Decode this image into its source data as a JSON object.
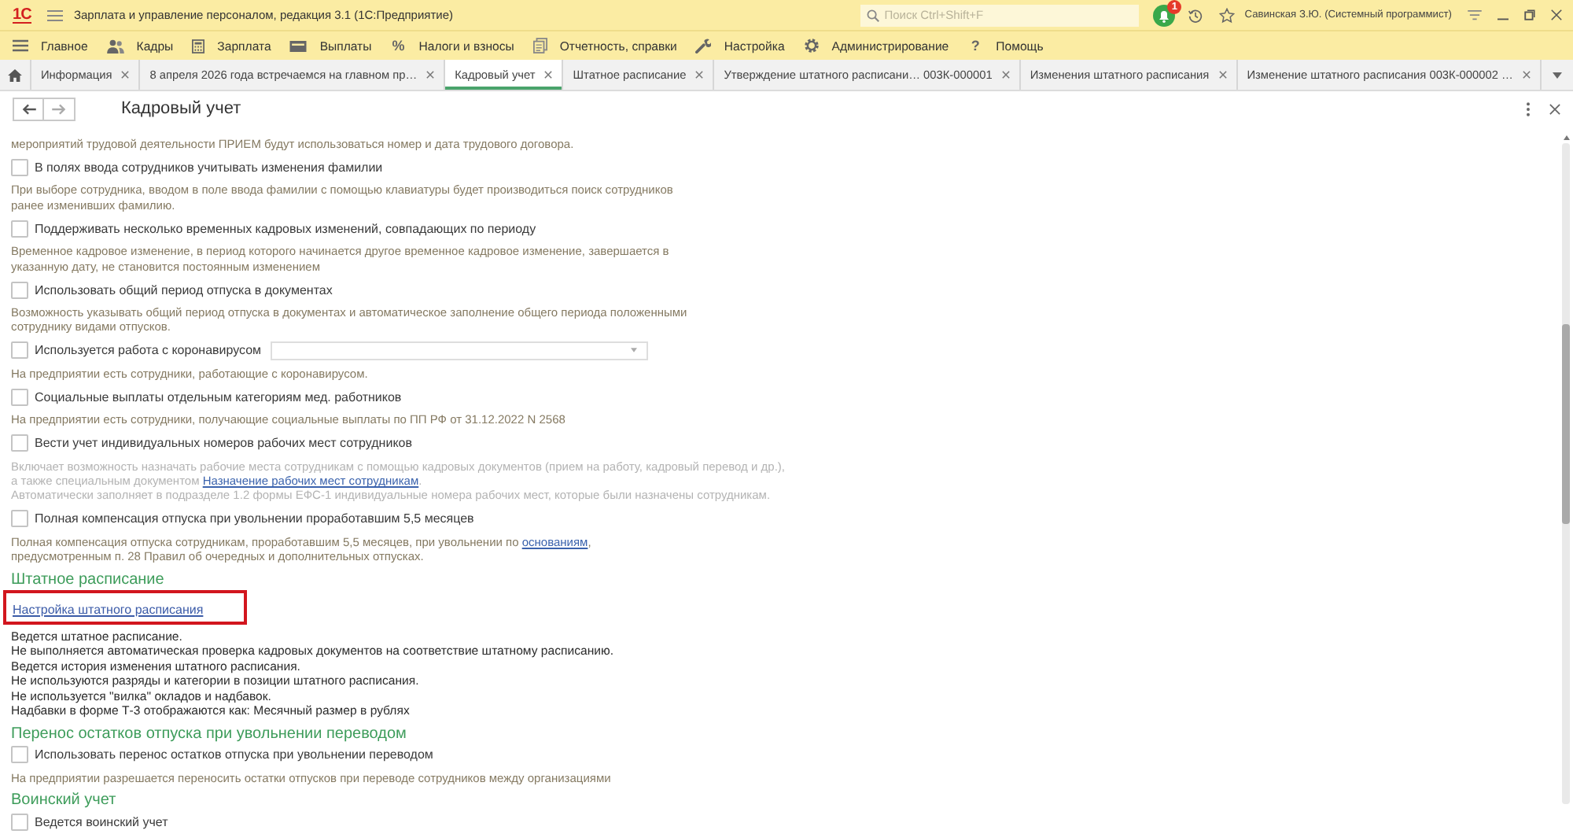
{
  "window": {
    "logo": "1С",
    "title": "Зарплата и управление персоналом, редакция 3.1 (1С:Предприятие)",
    "search": {
      "placeholder": "Поиск Ctrl+Shift+F"
    },
    "notification_count": "1",
    "user": "Савинская З.Ю. (Системный программист)"
  },
  "sections": [
    {
      "label": "Главное",
      "selected": false
    },
    {
      "label": "Кадры",
      "selected": false
    },
    {
      "label": "Зарплата",
      "selected": false
    },
    {
      "label": "Выплаты",
      "selected": false
    },
    {
      "label": "Налоги и взносы",
      "glyph": "%",
      "selected": false
    },
    {
      "label": "Отчетность, справки",
      "selected": false
    },
    {
      "label": "Настройка",
      "selected": false
    },
    {
      "label": "Администрирование",
      "selected": false
    },
    {
      "label": "Помощь",
      "glyph": "?",
      "selected": false
    }
  ],
  "tabs": [
    {
      "label": "Информация",
      "selected": false
    },
    {
      "label": "8 апреля 2026 года встречаемся на главном пр…",
      "selected": false
    },
    {
      "label": "Кадровый учет",
      "selected": true
    },
    {
      "label": "Штатное расписание",
      "selected": false
    },
    {
      "label": "Утверждение штатного расписани… 003К-000001",
      "selected": false
    },
    {
      "label": "Изменения штатного расписания",
      "selected": false
    },
    {
      "label": "Изменение штатного расписания 003К-000002 …",
      "selected": false
    }
  ],
  "form": {
    "title": "Кадровый учет"
  },
  "content": [
    {
      "kind": "note",
      "disabled": false,
      "lines": [
        "мероприятий трудовой деятельности ПРИЕМ будут использоваться номер и дата трудового договора."
      ]
    },
    {
      "kind": "checkbox",
      "label": "В полях ввода сотрудников учитывать изменения фамилии",
      "checked": false
    },
    {
      "kind": "note",
      "disabled": false,
      "lines": [
        "При выборе сотрудника, вводом в поле ввода фамилии с помощью клавиатуры будет производиться поиск сотрудников",
        "ранее изменивших фамилию."
      ]
    },
    {
      "kind": "checkbox",
      "label": "Поддерживать несколько временных кадровых изменений, совпадающих по периоду",
      "checked": false
    },
    {
      "kind": "note",
      "disabled": false,
      "lines": [
        "Временное кадровое изменение, в период которого начинается другое временное кадровое изменение, завершается в",
        "указанную дату, не становится постоянным изменением"
      ]
    },
    {
      "kind": "checkbox",
      "label": "Использовать общий период отпуска в документах",
      "checked": false
    },
    {
      "kind": "note",
      "disabled": false,
      "lines": [
        "Возможность указывать общий период отпуска в документах и автоматическое заполнение общего периода положенными",
        "сотруднику видами отпусков."
      ]
    },
    {
      "kind": "checkbox_select",
      "label": "Используется работа с коронавирусом",
      "checked": false
    },
    {
      "kind": "note",
      "disabled": false,
      "lines": [
        "На предприятии есть сотрудники, работающие с коронавирусом."
      ]
    },
    {
      "kind": "checkbox",
      "label": "Социальные выплаты отдельным категориям мед. работников",
      "checked": false
    },
    {
      "kind": "note",
      "disabled": false,
      "lines": [
        "На предприятии есть сотрудники, получающие социальные выплаты по ПП РФ от 31.12.2022 N 2568"
      ]
    },
    {
      "kind": "checkbox",
      "label": "Вести учет индивидуальных номеров рабочих мест сотрудников",
      "checked": false
    },
    {
      "kind": "note",
      "disabled": true,
      "lines": [
        "Включает возможность назначать рабочие места сотрудникам с помощью кадровых документов (прием на работу, кадровый перевод и др.),",
        [
          {
            "text": "а также специальным документом "
          },
          {
            "text": "Назначение рабочих мест сотрудникам",
            "link": true
          },
          {
            "text": "."
          }
        ],
        "Автоматически заполняет в подразделе 1.2 формы ЕФС-1 индивидуальные номера рабочих мест, которые были назначены сотрудникам."
      ]
    },
    {
      "kind": "checkbox",
      "label": "Полная компенсация отпуска при увольнении проработавшим 5,5 месяцев",
      "checked": false
    },
    {
      "kind": "note",
      "disabled": false,
      "lines": [
        [
          {
            "text": "Полная компенсация отпуска сотрудникам, проработавшим 5,5 месяцев, при увольнении по "
          },
          {
            "text": "основаниям",
            "link": true
          },
          {
            "text": ","
          }
        ],
        "предусмотренным п. 28 Правил об очередных и дополнительных отпусках."
      ]
    },
    {
      "kind": "heading",
      "text": "Штатное расписание"
    },
    {
      "kind": "link",
      "text": "Настройка штатного расписания",
      "highlighted": true
    },
    {
      "kind": "info",
      "text": "Ведется штатное расписание."
    },
    {
      "kind": "info",
      "text": "Не выполняется автоматическая проверка кадровых документов на соответствие штатному расписанию."
    },
    {
      "kind": "info",
      "text": "Ведется история изменения штатного расписания."
    },
    {
      "kind": "info",
      "text": "Не используются разряды и категории в позиции штатного расписания."
    },
    {
      "kind": "info",
      "text": "Не используется \"вилка\" окладов и надбавок."
    },
    {
      "kind": "info",
      "text": "Надбавки в форме Т-3 отображаются как: Месячный размер в рублях"
    },
    {
      "kind": "heading",
      "text": "Перенос остатков отпуска при увольнении переводом"
    },
    {
      "kind": "checkbox",
      "label": "Использовать перенос остатков отпуска при увольнении переводом",
      "checked": false
    },
    {
      "kind": "note",
      "disabled": false,
      "lines": [
        "На предприятии разрешается переносить остатки отпусков при переводе сотрудников между организациями"
      ]
    },
    {
      "kind": "heading",
      "text": "Воинский учет"
    },
    {
      "kind": "checkbox",
      "label": "Ведется воинский учет",
      "checked": false
    }
  ]
}
